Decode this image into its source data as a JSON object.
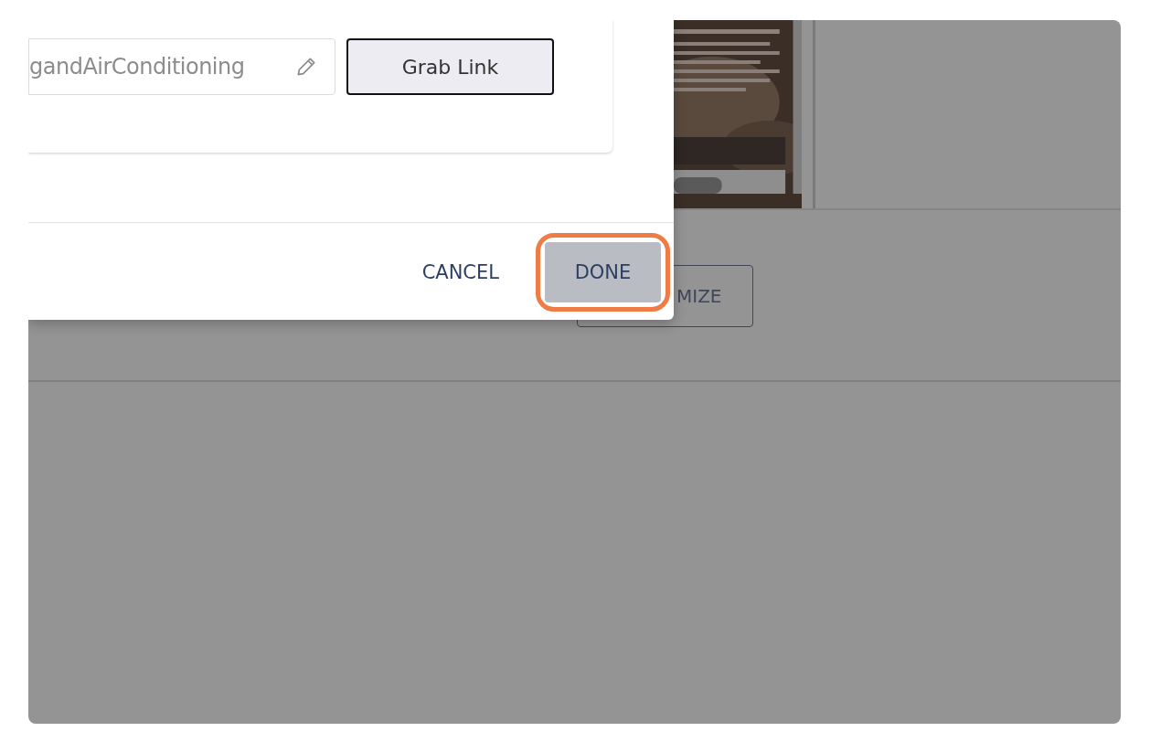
{
  "dialog": {
    "link_field": {
      "value": "gandAirConditioning"
    },
    "grab_button": "Grab Link",
    "actions": [
      {
        "label": "CANCEL",
        "kind": "text",
        "highlighted": false
      },
      {
        "label": "DONE",
        "kind": "primary",
        "highlighted": true
      }
    ]
  },
  "background": {
    "button": "MIZE"
  }
}
